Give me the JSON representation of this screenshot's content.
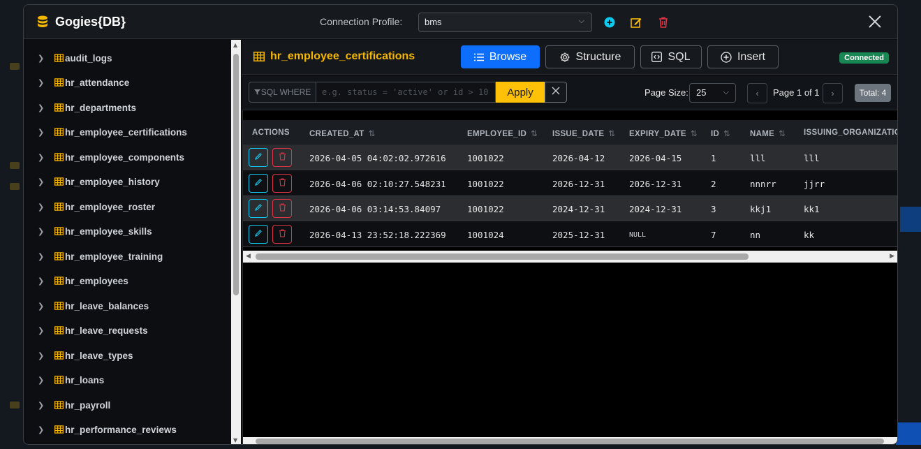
{
  "app": {
    "title": "Gogies{DB}"
  },
  "connection": {
    "label": "Connection Profile:",
    "selected": "bms"
  },
  "sidebar": {
    "tables": [
      "audit_logs",
      "hr_attendance",
      "hr_departments",
      "hr_employee_certifications",
      "hr_employee_components",
      "hr_employee_history",
      "hr_employee_roster",
      "hr_employee_skills",
      "hr_employee_training",
      "hr_employees",
      "hr_leave_balances",
      "hr_leave_requests",
      "hr_leave_types",
      "hr_loans",
      "hr_payroll",
      "hr_performance_reviews"
    ]
  },
  "main": {
    "table_name": "hr_employee_certifications",
    "tabs": {
      "browse": "Browse",
      "structure": "Structure",
      "sql": "SQL",
      "insert": "Insert"
    },
    "status": "Connected",
    "filter": {
      "label": "SQL WHERE",
      "placeholder": "e.g. status = 'active' or id > 10",
      "apply": "Apply"
    },
    "pagination": {
      "page_size_label": "Page Size:",
      "page_size": "25",
      "page_info": "Page 1 of 1",
      "total": "Total: 4"
    },
    "columns": [
      "ACTIONS",
      "CREATED_AT",
      "EMPLOYEE_ID",
      "ISSUE_DATE",
      "EXPIRY_DATE",
      "ID",
      "NAME",
      "ISSUING_ORGANIZATIO"
    ],
    "rows": [
      {
        "created_at": "2026-04-05 04:02:02.972616",
        "employee_id": "1001022",
        "issue_date": "2026-04-12",
        "expiry_date": "2026-04-15",
        "id": "1",
        "name": "lll",
        "issuing_org": "lll"
      },
      {
        "created_at": "2026-04-06 02:10:27.548231",
        "employee_id": "1001022",
        "issue_date": "2026-12-31",
        "expiry_date": "2026-12-31",
        "id": "2",
        "name": "nnnrr",
        "issuing_org": "jjrr"
      },
      {
        "created_at": "2026-04-06 03:14:53.84097",
        "employee_id": "1001022",
        "issue_date": "2024-12-31",
        "expiry_date": "2024-12-31",
        "id": "3",
        "name": "kkj1",
        "issuing_org": "kk1"
      },
      {
        "created_at": "2026-04-13 23:52:18.222369",
        "employee_id": "1001024",
        "issue_date": "2025-12-31",
        "expiry_date": "NULL",
        "id": "7",
        "name": "nn",
        "issuing_org": "kk"
      }
    ]
  },
  "colors": {
    "accent": "#0d6efd",
    "table_icon": "#f5b700",
    "apply": "#ffc107",
    "connected": "#198754",
    "edit": "#0dcaf0",
    "delete": "#dc3545"
  }
}
